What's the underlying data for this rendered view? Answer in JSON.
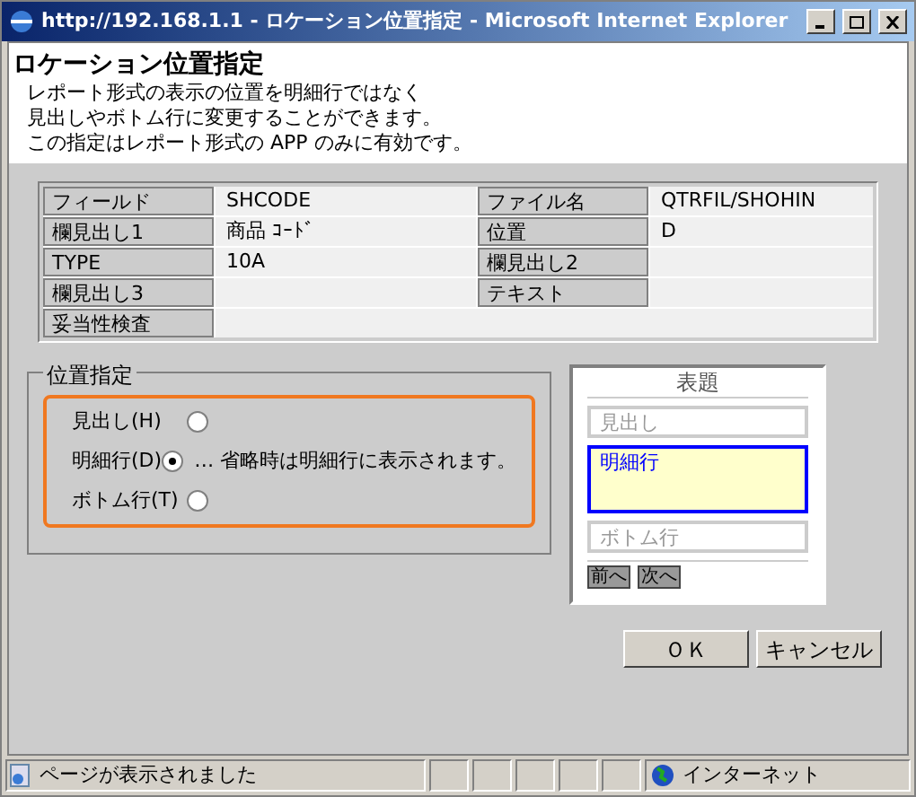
{
  "window": {
    "title": "http://192.168.1.1 - ロケーション位置指定 - Microsoft Internet Explorer"
  },
  "header": {
    "title": "ロケーション位置指定",
    "lines": [
      "レポート形式の表示の位置を明細行ではなく",
      "見出しやボトム行に変更することができます。",
      "この指定はレポート形式の APP のみに有効です。"
    ]
  },
  "table": {
    "rows": [
      {
        "cells": [
          {
            "label": "フィールド",
            "value": "SHCODE"
          },
          {
            "label": "ファイル名",
            "value": "QTRFIL/SHOHIN"
          }
        ]
      },
      {
        "cells": [
          {
            "label": "欄見出し1",
            "value": "商品 ｺｰﾄﾞ"
          },
          {
            "label": "位置",
            "value": "D"
          }
        ]
      },
      {
        "cells": [
          {
            "label": "TYPE",
            "value": "10A"
          },
          {
            "label": "欄見出し2"
          }
        ]
      },
      {
        "cells": [
          {
            "label": "欄見出し3"
          },
          {
            "label": "テキスト"
          }
        ]
      },
      {
        "cells": [
          {
            "label": "妥当性検査"
          }
        ]
      }
    ]
  },
  "position": {
    "legend": "位置指定",
    "options": [
      {
        "label": "見出し(H)",
        "selected": false
      },
      {
        "label": "明細行(D)",
        "selected": true,
        "note": "… 省略時は明細行に表示されます。"
      },
      {
        "label": "ボトム行(T)",
        "selected": false
      }
    ]
  },
  "preview": {
    "title": "表題",
    "rows": [
      {
        "label": "見出し",
        "selected": false
      },
      {
        "label": "明細行",
        "selected": true
      },
      {
        "label": "ボトム行",
        "selected": false
      }
    ],
    "nav": [
      "前へ",
      "次へ"
    ]
  },
  "buttons": [
    "ＯＫ",
    "キャンセル"
  ],
  "status_bar": {
    "message": "ページが表示されました",
    "zone": "インターネット"
  }
}
